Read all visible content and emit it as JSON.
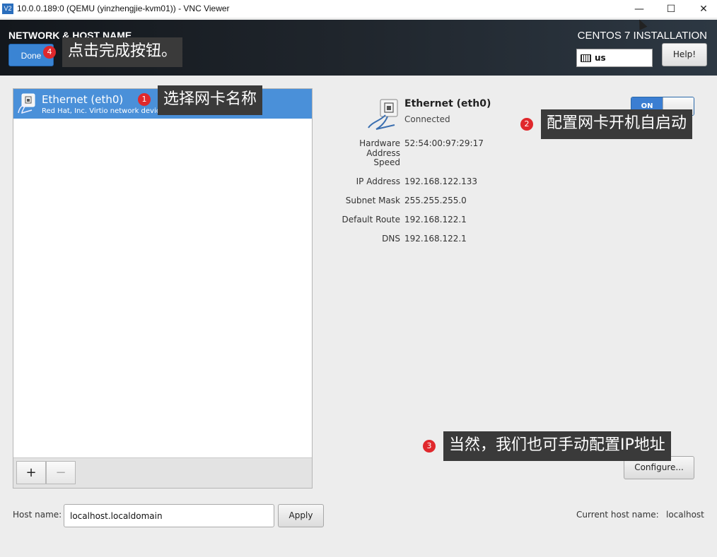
{
  "window": {
    "title": "10.0.0.189:0 (QEMU (yinzhengjie-kvm01)) - VNC Viewer",
    "logo": "V2",
    "minimize": "—",
    "maximize": "☐",
    "close": "✕"
  },
  "header": {
    "title": "NETWORK & HOST NAME",
    "done_label": "Done",
    "installer_title": "CENTOS 7 INSTALLATION",
    "keyboard_layout": "us",
    "help_label": "Help!"
  },
  "devices": [
    {
      "name": "Ethernet (eth0)",
      "description": "Red Hat, Inc. Virtio network device"
    }
  ],
  "device_toolbar": {
    "add_label": "+",
    "remove_label": "−"
  },
  "detail": {
    "name": "Ethernet (eth0)",
    "status": "Connected",
    "toggle_label": "ON",
    "fields": [
      {
        "label": "Hardware Address",
        "value": "52:54:00:97:29:17"
      },
      {
        "label": "Speed",
        "value": ""
      },
      {
        "label": "IP Address",
        "value": "192.168.122.133"
      },
      {
        "label": "Subnet Mask",
        "value": "255.255.255.0"
      },
      {
        "label": "Default Route",
        "value": "192.168.122.1"
      },
      {
        "label": "DNS",
        "value": "192.168.122.1"
      }
    ],
    "configure_label": "Configure..."
  },
  "hostname": {
    "label": "Host name:",
    "value": "localhost.localdomain",
    "apply_label": "Apply",
    "current_label": "Current host name:",
    "current_value": "localhost"
  },
  "annotations": [
    {
      "number": "1",
      "text": "选择网卡名称"
    },
    {
      "number": "2",
      "text": "配置网卡开机自启动"
    },
    {
      "number": "3",
      "text": "当然，我们也可手动配置IP地址"
    },
    {
      "number": "4",
      "text": "点击完成按钮。"
    }
  ],
  "colors": {
    "accent_blue": "#4a90d9",
    "done_blue": "#3a84d3",
    "header_dark": "#13171c",
    "badge_red": "#e0282c",
    "callout_bg": "#3a3a3a"
  }
}
